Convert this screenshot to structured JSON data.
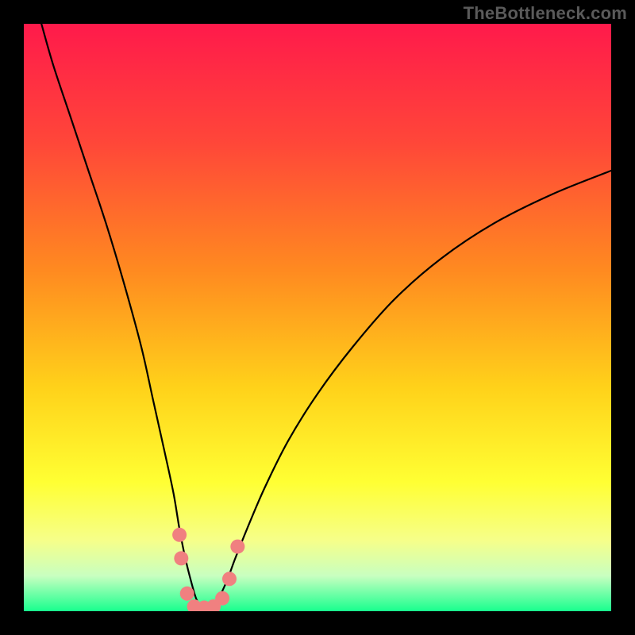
{
  "watermark": "TheBottleneck.com",
  "chart_data": {
    "type": "line",
    "title": "",
    "xlabel": "",
    "ylabel": "",
    "xlim": [
      0,
      100
    ],
    "ylim": [
      0,
      100
    ],
    "legend": false,
    "grid": false,
    "gradient_stops": [
      {
        "pos": 0.0,
        "color": "#ff1a4b"
      },
      {
        "pos": 0.2,
        "color": "#ff4639"
      },
      {
        "pos": 0.42,
        "color": "#ff8a20"
      },
      {
        "pos": 0.62,
        "color": "#ffd21a"
      },
      {
        "pos": 0.78,
        "color": "#ffff33"
      },
      {
        "pos": 0.88,
        "color": "#f6ff8a"
      },
      {
        "pos": 0.94,
        "color": "#c8ffc0"
      },
      {
        "pos": 1.0,
        "color": "#18ff8e"
      }
    ],
    "series": [
      {
        "name": "bottleneck-curve",
        "stroke": "#000000",
        "stroke_width": 2.2,
        "x": [
          3,
          5,
          8,
          11,
          14,
          17,
          20,
          22,
          24,
          25.5,
          26.5,
          27.5,
          28.5,
          29.4,
          30.4,
          31.5,
          33,
          34.5,
          36,
          38,
          41,
          45,
          50,
          56,
          63,
          71,
          80,
          90,
          100
        ],
        "y": [
          100,
          93,
          84,
          75,
          66,
          56,
          45,
          36,
          27,
          20,
          14,
          9,
          5,
          2,
          0.5,
          0.5,
          2,
          5,
          9,
          14,
          21,
          29,
          37,
          45,
          53,
          60,
          66,
          71,
          75
        ]
      }
    ],
    "scatter": {
      "name": "trough-markers",
      "color": "#f08080",
      "radius": 9,
      "points": [
        {
          "x": 26.5,
          "y": 13
        },
        {
          "x": 26.8,
          "y": 9
        },
        {
          "x": 27.8,
          "y": 3
        },
        {
          "x": 29.0,
          "y": 0.8
        },
        {
          "x": 30.7,
          "y": 0.6
        },
        {
          "x": 32.3,
          "y": 0.8
        },
        {
          "x": 33.8,
          "y": 2.2
        },
        {
          "x": 35.0,
          "y": 5.5
        },
        {
          "x": 36.4,
          "y": 11
        }
      ]
    }
  }
}
